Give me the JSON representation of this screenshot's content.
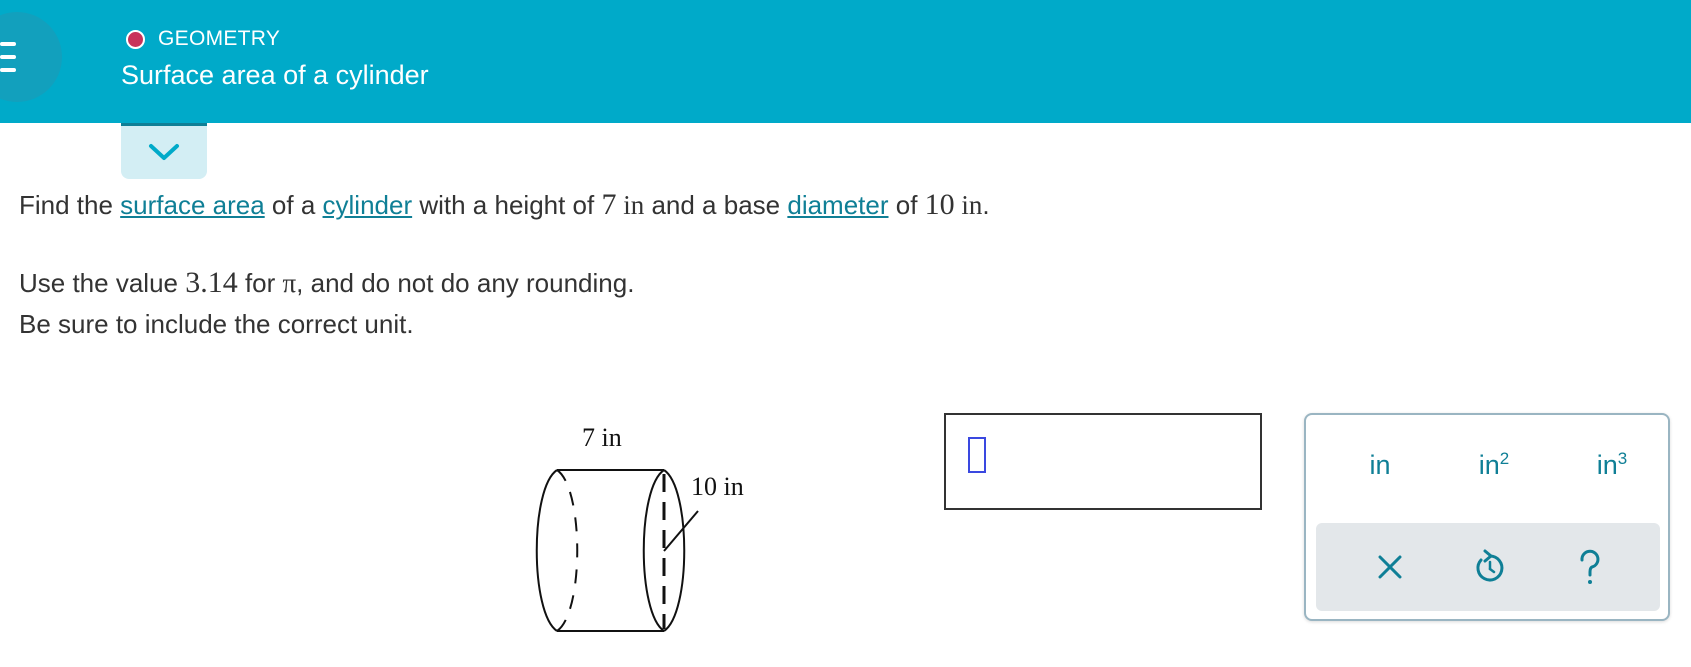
{
  "header": {
    "topic": "GEOMETRY",
    "title": "Surface area of a cylinder",
    "colors": {
      "bar": "#00aac9",
      "topic_dot": "#c8325a"
    }
  },
  "question": {
    "line1": {
      "t1": "Find the ",
      "link1": "surface area",
      "t2": " of a ",
      "link2": "cylinder",
      "t3": " with a height of ",
      "height_val": "7",
      "height_unit": " in",
      "t4": " and a base ",
      "link3": "diameter",
      "t5": " of ",
      "diameter_val": "10",
      "diameter_unit": " in",
      "t6": "."
    },
    "line2": {
      "t1": "Use the value ",
      "pi_val": "3.14",
      "t2": " for ",
      "pi": "π",
      "t3": ", and do not do any rounding."
    },
    "line3": "Be sure to include the correct unit."
  },
  "figure": {
    "height_label": "7 in",
    "diameter_label": "10 in"
  },
  "answer": {
    "value": ""
  },
  "keypad": {
    "units": [
      {
        "base": "in",
        "exp": ""
      },
      {
        "base": "in",
        "exp": "2"
      },
      {
        "base": "in",
        "exp": "3"
      }
    ],
    "tools": [
      "clear-icon",
      "undo-icon",
      "help-icon"
    ]
  }
}
